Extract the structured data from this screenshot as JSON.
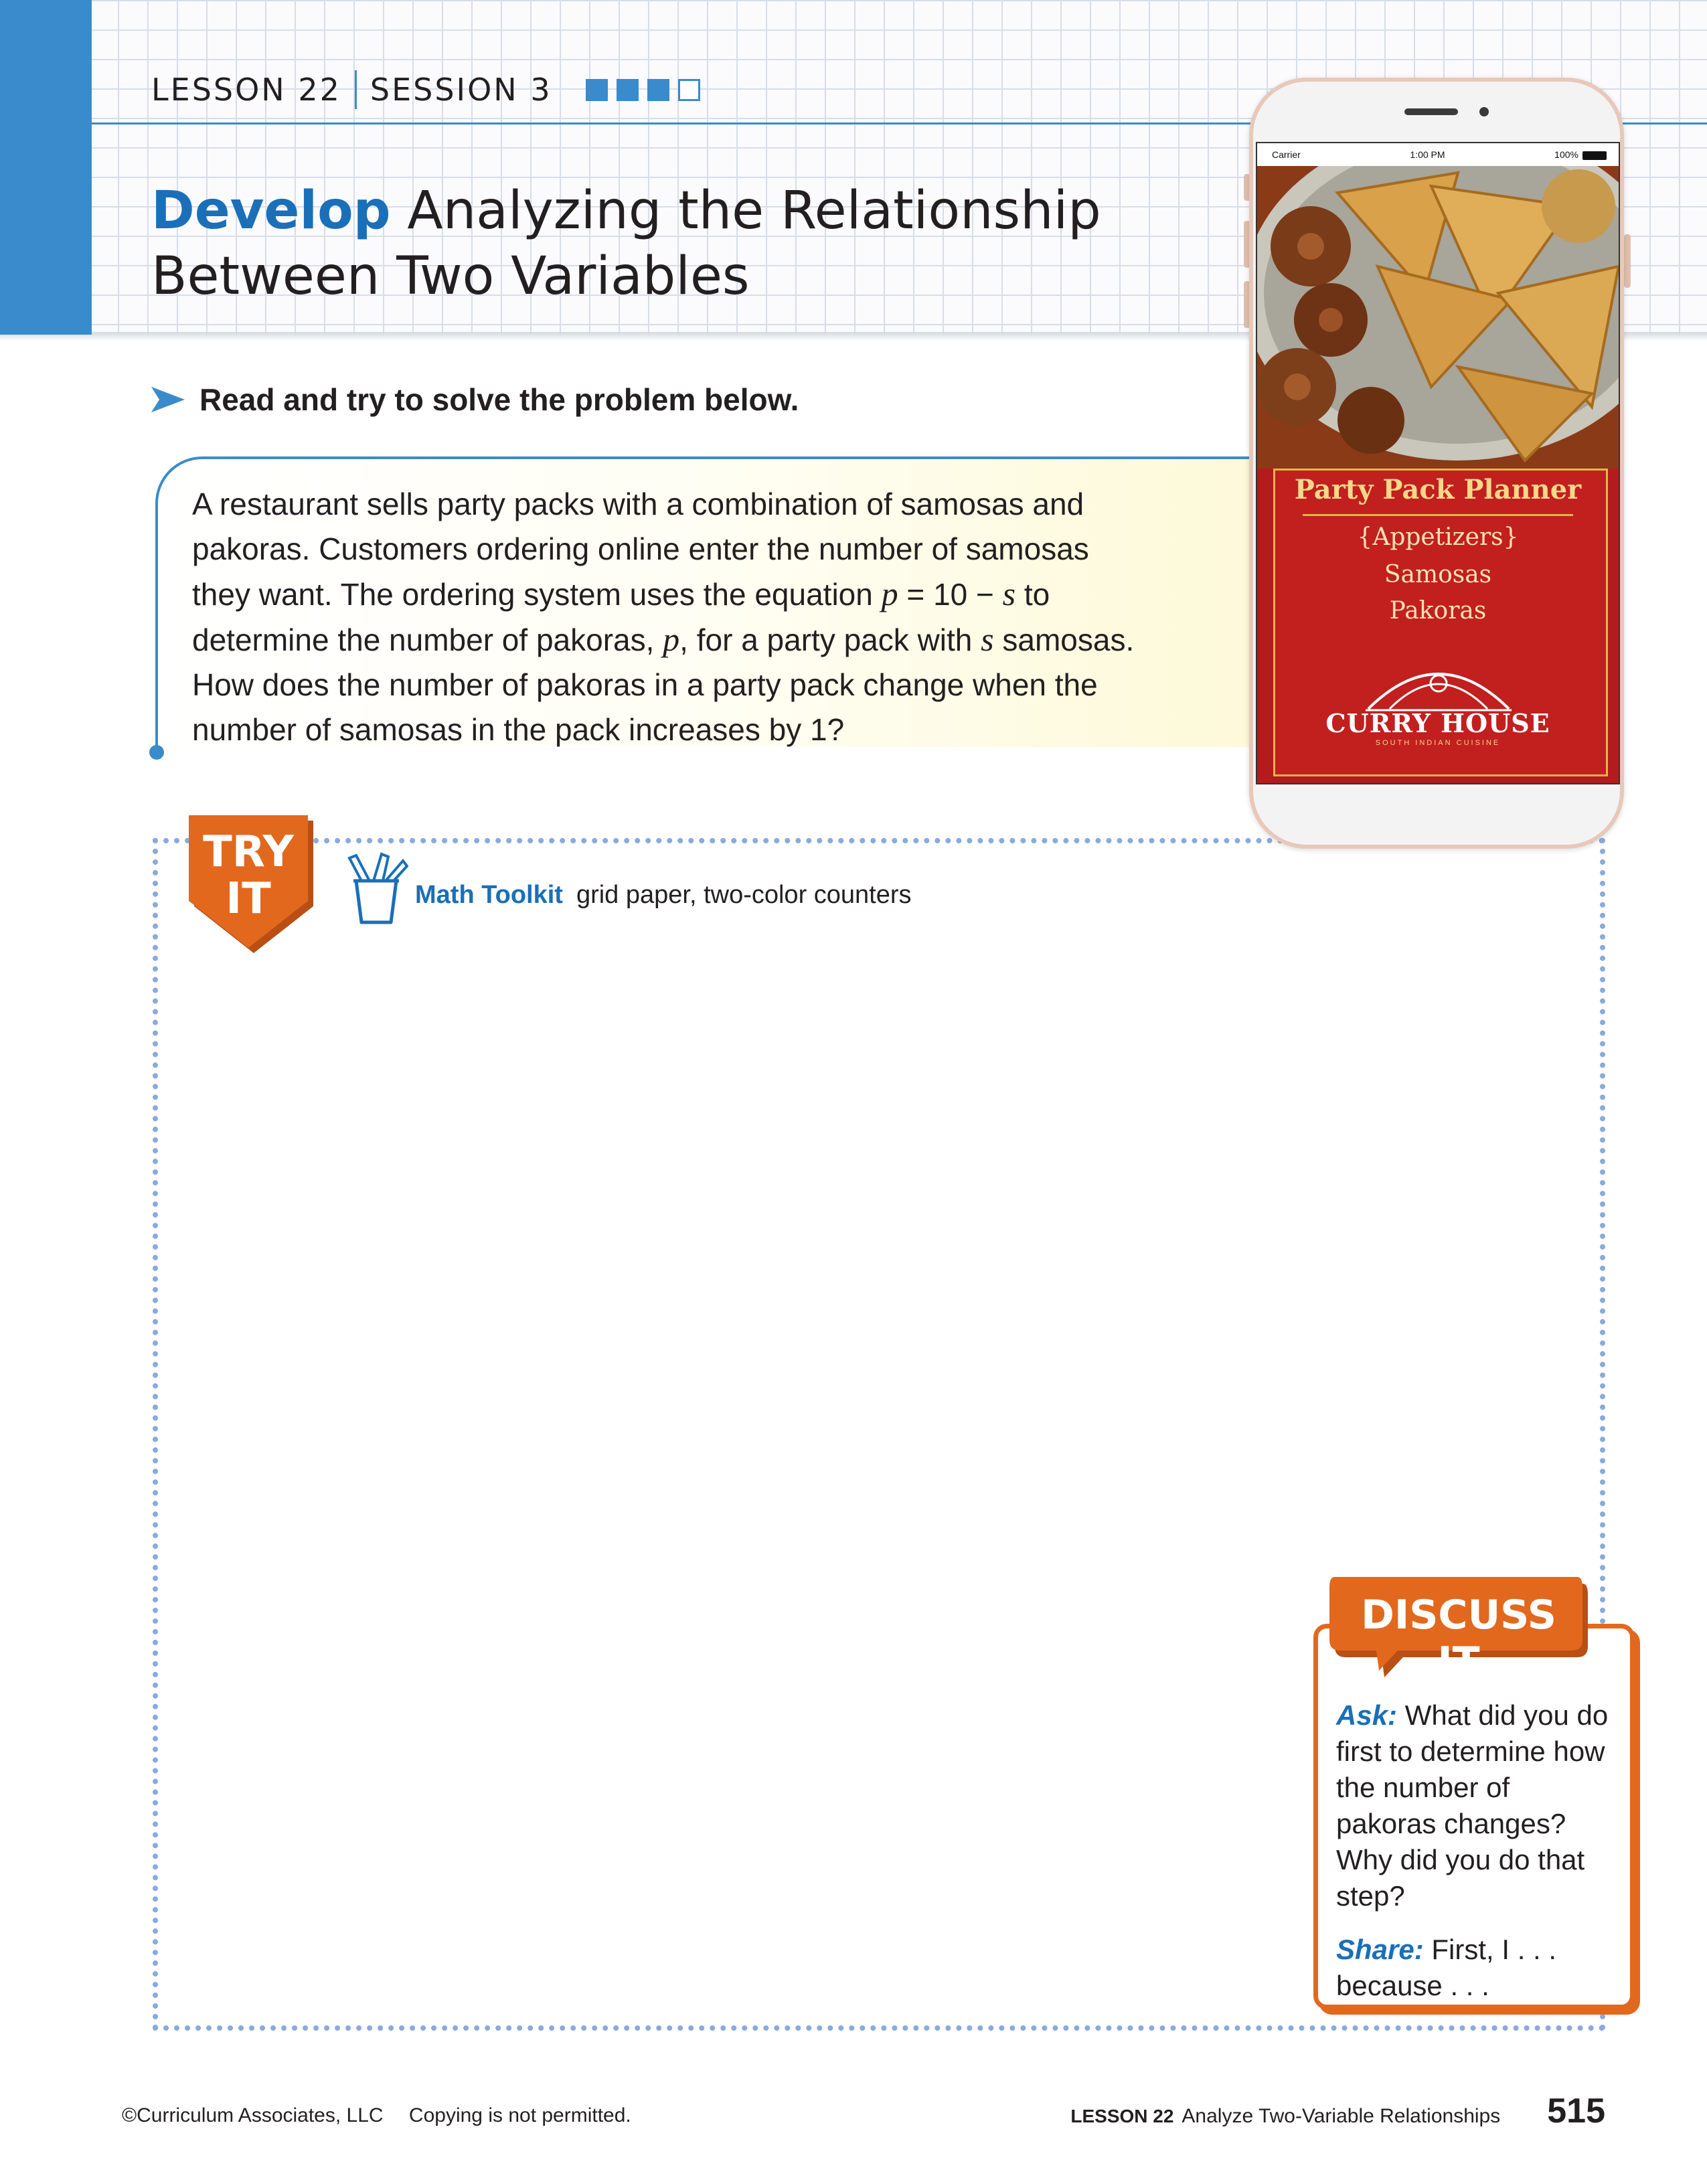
{
  "header": {
    "lesson": "LESSON 22",
    "session": "SESSION 3",
    "progress": {
      "completed": 3,
      "total": 4
    },
    "title_bold": "Develop",
    "title_line1": "Analyzing the Relationship",
    "title_line2": "Between Two Variables"
  },
  "instruction": "Read and try to solve the problem below.",
  "problem": {
    "line1": "A restaurant sells party packs with a combination of samosas and",
    "line2": "pakoras. Customers ordering online enter the number of samosas",
    "line3_a": "they want. The ordering system uses the equation ",
    "line3_var_p": "p",
    "line3_eq": " = 10 − ",
    "line3_var_s": "s",
    "line3_b": " to",
    "line4_a": "determine the number of pakoras, ",
    "line4_var_p": "p",
    "line4_b": ", for a party pack with ",
    "line4_var_s": "s",
    "line4_c": " samosas.",
    "line5": "How does the number of pakoras in a party pack change when the",
    "line6": "number of samosas in the pack increases by 1?"
  },
  "try_it": {
    "badge_line1": "TRY",
    "badge_line2": "IT",
    "toolkit_label": "Math Toolkit",
    "toolkit_items": "grid paper, two-color counters"
  },
  "phone": {
    "status_carrier": "Carrier",
    "status_time": "1:00 PM",
    "status_battery": "100%",
    "menu_title": "Party Pack Planner",
    "menu_subtitle": "{Appetizers}",
    "menu_item1": "Samosas",
    "menu_item2": "Pakoras",
    "brand": "CURRY HOUSE",
    "brand_sub": "SOUTH INDIAN CUISINE"
  },
  "discuss": {
    "title": "DISCUSS IT",
    "ask_label": "Ask:",
    "ask_text": "What did you do first to determine how the number of pakoras changes? Why did you do that step?",
    "share_label": "Share:",
    "share_text": "First, I . . . because . . ."
  },
  "footer": {
    "copyright": "©Curriculum Associates, LLC",
    "notice": "Copying is not permitted.",
    "lesson": "LESSON 22",
    "lesson_name": "Analyze Two-Variable Relationships",
    "page_number": "515"
  },
  "colors": {
    "accent_blue": "#3a8bcb",
    "title_blue": "#1a6fb8",
    "orange": "#e2681e",
    "dotted_border": "#8aa9df"
  }
}
